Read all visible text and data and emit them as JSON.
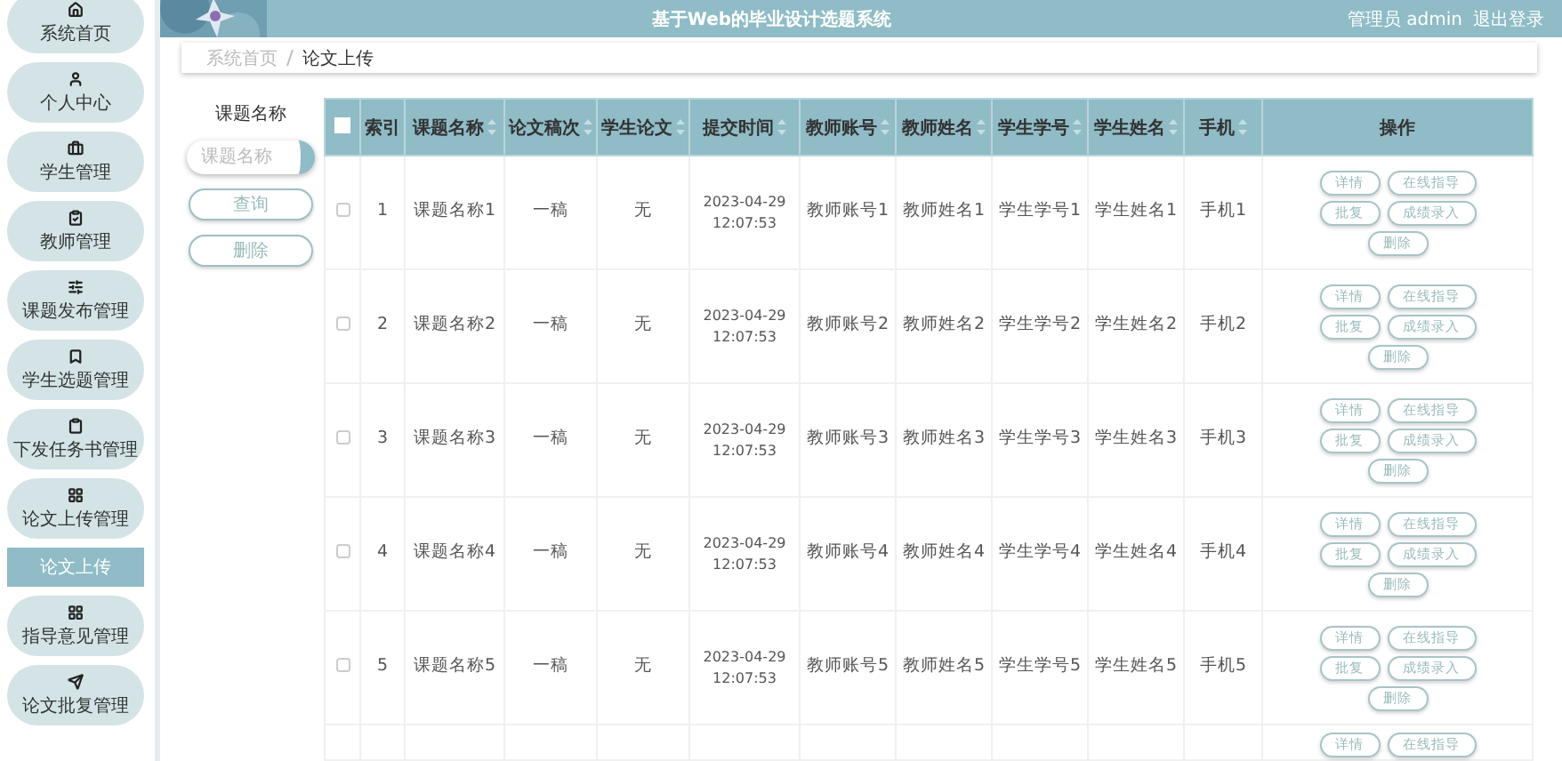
{
  "header": {
    "title": "基于Web的毕业设计选题系统",
    "user": "管理员 admin",
    "logout": "退出登录"
  },
  "sidebar": {
    "items": [
      {
        "label": "系统首页",
        "selected": false
      },
      {
        "label": "个人中心",
        "selected": false
      },
      {
        "label": "学生管理",
        "selected": false
      },
      {
        "label": "教师管理",
        "selected": false
      },
      {
        "label": "课题发布管理",
        "selected": false
      },
      {
        "label": "学生选题管理",
        "selected": false
      },
      {
        "label": "下发任务书管理",
        "selected": false
      },
      {
        "label": "论文上传管理",
        "selected": false,
        "expanded": true,
        "children": [
          {
            "label": "论文上传",
            "selected": true
          }
        ]
      },
      {
        "label": "指导意见管理",
        "selected": false
      },
      {
        "label": "论文批复管理",
        "selected": false
      }
    ]
  },
  "breadcrumb": [
    "系统首页",
    "论文上传"
  ],
  "search": {
    "label": "课题名称",
    "placeholder": "课题名称",
    "buttons": [
      "查询",
      "删除"
    ]
  },
  "table": {
    "all_checked": false,
    "columns": [
      "索引",
      "课题名称",
      "论文稿次",
      "学生论文",
      "提交时间",
      "教师账号",
      "教师姓名",
      "学生学号",
      "学生姓名",
      "手机",
      "操作"
    ],
    "rows": [
      {
        "checked": false,
        "cells": [
          "1",
          "课题名称1",
          "一稿",
          "无",
          "2023-04-29 12:07:53",
          "教师账号1",
          "教师姓名1",
          "学生学号1",
          "学生姓名1",
          "手机1"
        ],
        "actions": [
          "详情",
          "在线指导",
          "批复",
          "成绩录入",
          "删除"
        ]
      },
      {
        "checked": false,
        "cells": [
          "2",
          "课题名称2",
          "一稿",
          "无",
          "2023-04-29 12:07:53",
          "教师账号2",
          "教师姓名2",
          "学生学号2",
          "学生姓名2",
          "手机2"
        ],
        "actions": [
          "详情",
          "在线指导",
          "批复",
          "成绩录入",
          "删除"
        ]
      },
      {
        "checked": false,
        "cells": [
          "3",
          "课题名称3",
          "一稿",
          "无",
          "2023-04-29 12:07:53",
          "教师账号3",
          "教师姓名3",
          "学生学号3",
          "学生姓名3",
          "手机3"
        ],
        "actions": [
          "详情",
          "在线指导",
          "批复",
          "成绩录入",
          "删除"
        ]
      },
      {
        "checked": false,
        "cells": [
          "4",
          "课题名称4",
          "一稿",
          "无",
          "2023-04-29 12:07:53",
          "教师账号4",
          "教师姓名4",
          "学生学号4",
          "学生姓名4",
          "手机4"
        ],
        "actions": [
          "详情",
          "在线指导",
          "批复",
          "成绩录入",
          "删除"
        ]
      },
      {
        "checked": false,
        "cells": [
          "5",
          "课题名称5",
          "一稿",
          "无",
          "2023-04-29 12:07:53",
          "教师账号5",
          "教师姓名5",
          "学生学号5",
          "学生姓名5",
          "手机5"
        ],
        "actions": [
          "详情",
          "在线指导",
          "批复",
          "成绩录入",
          "删除"
        ]
      }
    ],
    "partial_row": {
      "actions": [
        "详情",
        "在线指导"
      ]
    }
  }
}
